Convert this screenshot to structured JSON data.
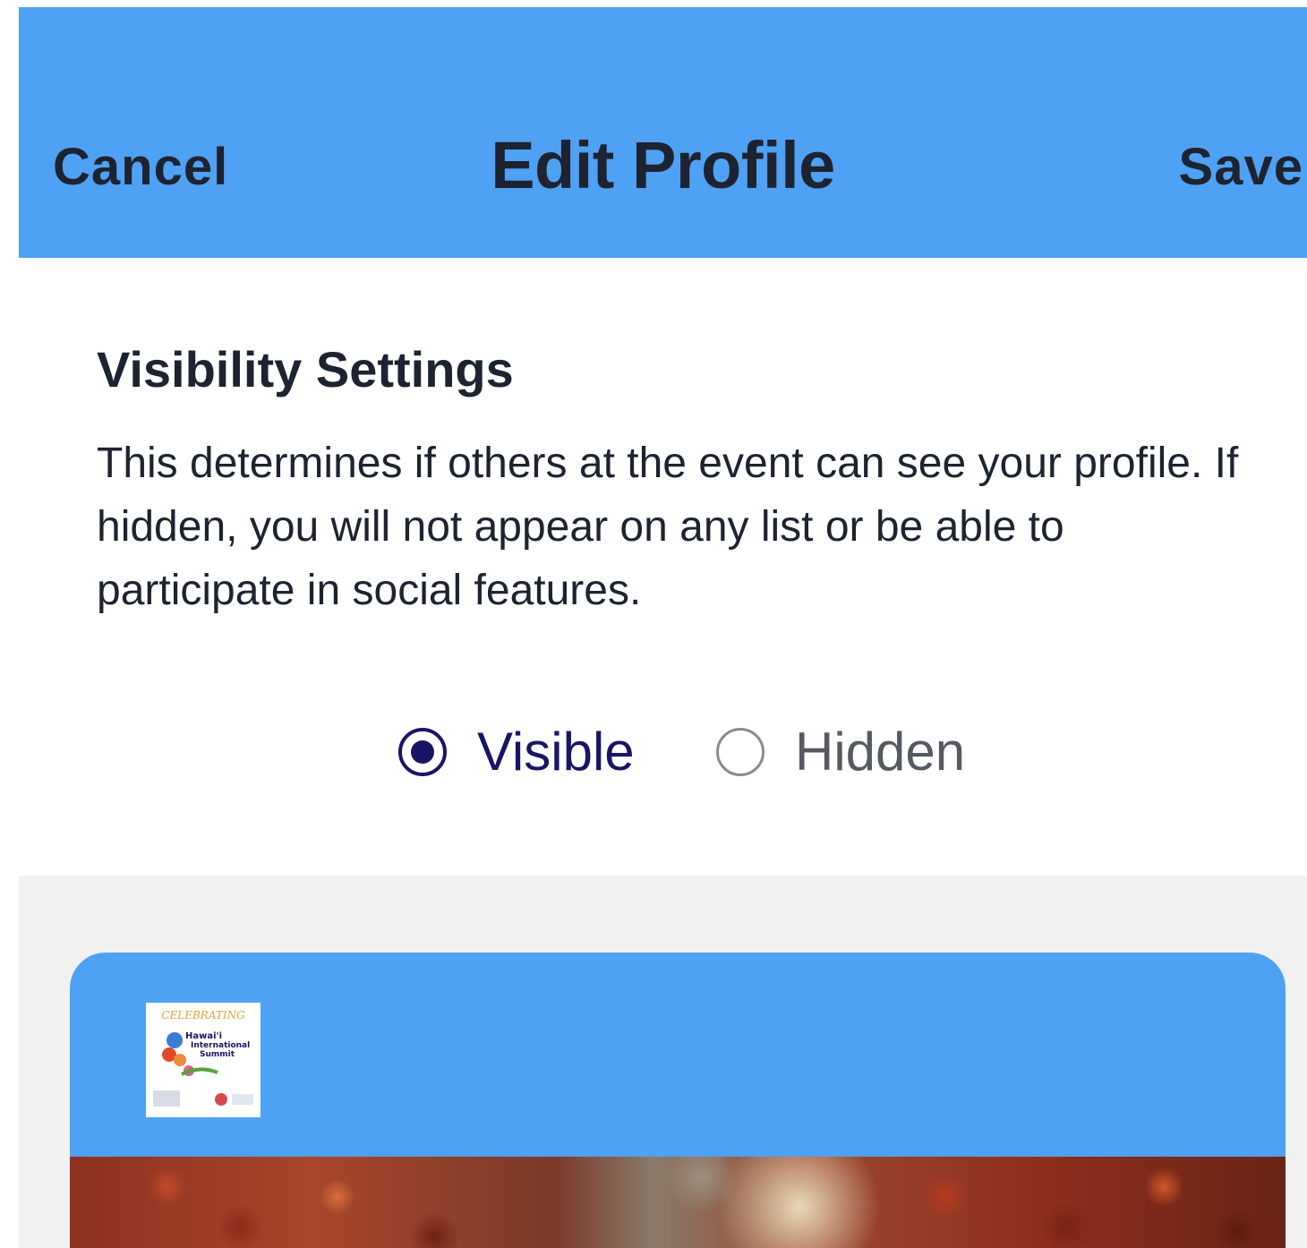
{
  "header": {
    "cancel_label": "Cancel",
    "title": "Edit Profile",
    "save_label": "Save"
  },
  "visibility": {
    "title": "Visibility Settings",
    "description": "This determines if others at the event can see your profile. If hidden, you will not appear on any list or be able to participate in social features.",
    "options": [
      {
        "label": "Visible",
        "selected": true
      },
      {
        "label": "Hidden",
        "selected": false
      }
    ]
  },
  "logo": {
    "text_top": "CELEBRATING",
    "text_line1": "Hawai'i",
    "text_line2": "International",
    "text_line3": "Summit"
  },
  "colors": {
    "header_bg": "#4fa1f3",
    "radio_selected": "#1a1464",
    "radio_unselected": "#8a8a8a",
    "gray_bg": "#f1f1f1"
  }
}
